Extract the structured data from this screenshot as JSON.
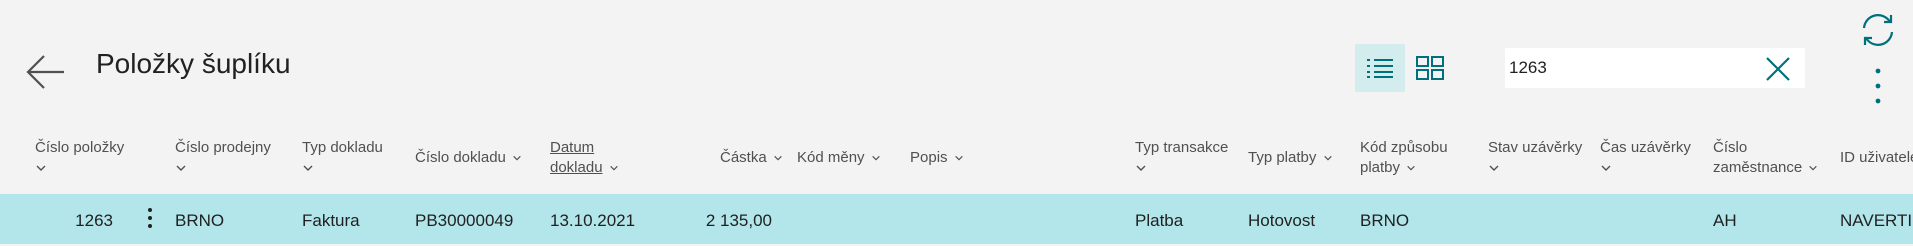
{
  "page": {
    "title": "Položky šuplíku"
  },
  "toolbar": {
    "view_list_icon": "list-view-icon",
    "view_tiles_icon": "tile-view-icon"
  },
  "search": {
    "value": "1263",
    "clear_icon": "close-icon"
  },
  "actions": {
    "refresh_icon": "refresh-icon",
    "more_icon": "vertical-ellipsis-icon"
  },
  "columns": [
    {
      "line1": "Číslo položky",
      "line2": ""
    },
    {
      "line1": "Číslo prodejny",
      "line2": ""
    },
    {
      "line1": "Typ dokladu",
      "line2": ""
    },
    {
      "line1": "Číslo dokladu",
      "line2": ""
    },
    {
      "line1": "Datum",
      "line2": "dokladu"
    },
    {
      "line1": "Částka",
      "line2": ""
    },
    {
      "line1": "Kód měny",
      "line2": ""
    },
    {
      "line1": "Popis",
      "line2": ""
    },
    {
      "line1": "Typ transakce",
      "line2": ""
    },
    {
      "line1": "Typ platby",
      "line2": ""
    },
    {
      "line1": "Kód způsobu",
      "line2": "platby"
    },
    {
      "line1": "Stav uzávěrky",
      "line2": ""
    },
    {
      "line1": "Čas uzávěrky",
      "line2": ""
    },
    {
      "line1": "Číslo",
      "line2": "zaměstnance"
    },
    {
      "line1": "ID uživatele",
      "line2": ""
    }
  ],
  "rows": [
    {
      "cislo_polozky": "1263",
      "cislo_prodejny": "BRNO",
      "typ_dokladu": "Faktura",
      "cislo_dokladu": "PB30000049",
      "datum_dokladu": "13.10.2021",
      "castka": "2 135,00",
      "kod_meny": "",
      "popis": "",
      "typ_transakce": "Platba",
      "typ_platby": "Hotovost",
      "kod_zpusobu_platby": "BRNO",
      "stav_uzaverky": "",
      "cas_uzaverky": "",
      "cislo_zamestnance": "AH",
      "id_uzivatele": "NAVERTIC"
    }
  ],
  "colors": {
    "accent": "#00707a",
    "selected_row": "#b2e6ea",
    "active_view": "#d3ecee",
    "background": "#f3f3f3"
  }
}
